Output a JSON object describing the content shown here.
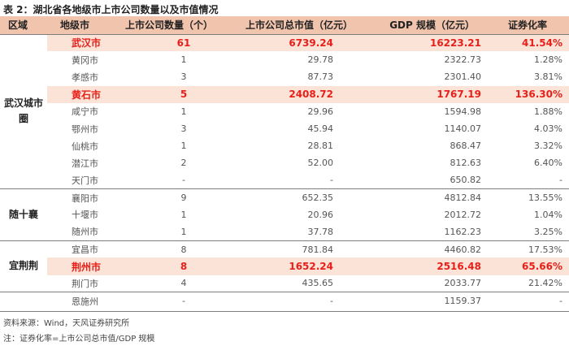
{
  "title": "表 2：湖北省各地级市上市公司数量以及市值情况",
  "headers": {
    "region": "区域",
    "city": "地级市",
    "count": "上市公司数量（个）",
    "cap": "上市公司总市值（亿元）",
    "gdp": "GDP 规模（亿元）",
    "ratio": "证券化率"
  },
  "groups": [
    {
      "region": "武汉城市圈",
      "rows": [
        {
          "city": "武汉市",
          "count": "61",
          "cap": "6739.24",
          "gdp": "16223.21",
          "ratio": "41.54%",
          "highlight": true
        },
        {
          "city": "黄冈市",
          "count": "1",
          "cap": "29.78",
          "gdp": "2322.73",
          "ratio": "1.28%",
          "highlight": false
        },
        {
          "city": "孝感市",
          "count": "3",
          "cap": "87.73",
          "gdp": "2301.40",
          "ratio": "3.81%",
          "highlight": false
        },
        {
          "city": "黄石市",
          "count": "5",
          "cap": "2408.72",
          "gdp": "1767.19",
          "ratio": "136.30%",
          "highlight": true
        },
        {
          "city": "咸宁市",
          "count": "1",
          "cap": "29.96",
          "gdp": "1594.98",
          "ratio": "1.88%",
          "highlight": false
        },
        {
          "city": "鄂州市",
          "count": "3",
          "cap": "45.94",
          "gdp": "1140.07",
          "ratio": "4.03%",
          "highlight": false
        },
        {
          "city": "仙桃市",
          "count": "1",
          "cap": "28.81",
          "gdp": "868.47",
          "ratio": "3.32%",
          "highlight": false
        },
        {
          "city": "潜江市",
          "count": "2",
          "cap": "52.00",
          "gdp": "812.63",
          "ratio": "6.40%",
          "highlight": false
        },
        {
          "city": "天门市",
          "count": "-",
          "cap": "-",
          "gdp": "650.82",
          "ratio": "-",
          "highlight": false
        }
      ]
    },
    {
      "region": "随十襄",
      "rows": [
        {
          "city": "襄阳市",
          "count": "9",
          "cap": "652.35",
          "gdp": "4812.84",
          "ratio": "13.55%",
          "highlight": false
        },
        {
          "city": "十堰市",
          "count": "1",
          "cap": "20.96",
          "gdp": "2012.72",
          "ratio": "1.04%",
          "highlight": false
        },
        {
          "city": "随州市",
          "count": "1",
          "cap": "37.78",
          "gdp": "1162.23",
          "ratio": "3.25%",
          "highlight": false
        }
      ]
    },
    {
      "region": "宜荆荆",
      "rows": [
        {
          "city": "宜昌市",
          "count": "8",
          "cap": "781.84",
          "gdp": "4460.82",
          "ratio": "17.53%",
          "highlight": false
        },
        {
          "city": "荆州市",
          "count": "8",
          "cap": "1652.24",
          "gdp": "2516.48",
          "ratio": "65.66%",
          "highlight": true
        },
        {
          "city": "荆门市",
          "count": "4",
          "cap": "435.65",
          "gdp": "2033.77",
          "ratio": "21.42%",
          "highlight": false
        }
      ]
    },
    {
      "region": "",
      "rows": [
        {
          "city": "恩施州",
          "count": "-",
          "cap": "-",
          "gdp": "1159.37",
          "ratio": "-",
          "highlight": false
        }
      ]
    }
  ],
  "source": "资料来源：Wind，天风证券研究所",
  "note": "注：证券化率=上市公司总市值/GDP 规模",
  "colors": {
    "header_bg": "#f1c4ad",
    "highlight_bg": "#fbe4d7",
    "highlight_text": "#e8201a"
  }
}
